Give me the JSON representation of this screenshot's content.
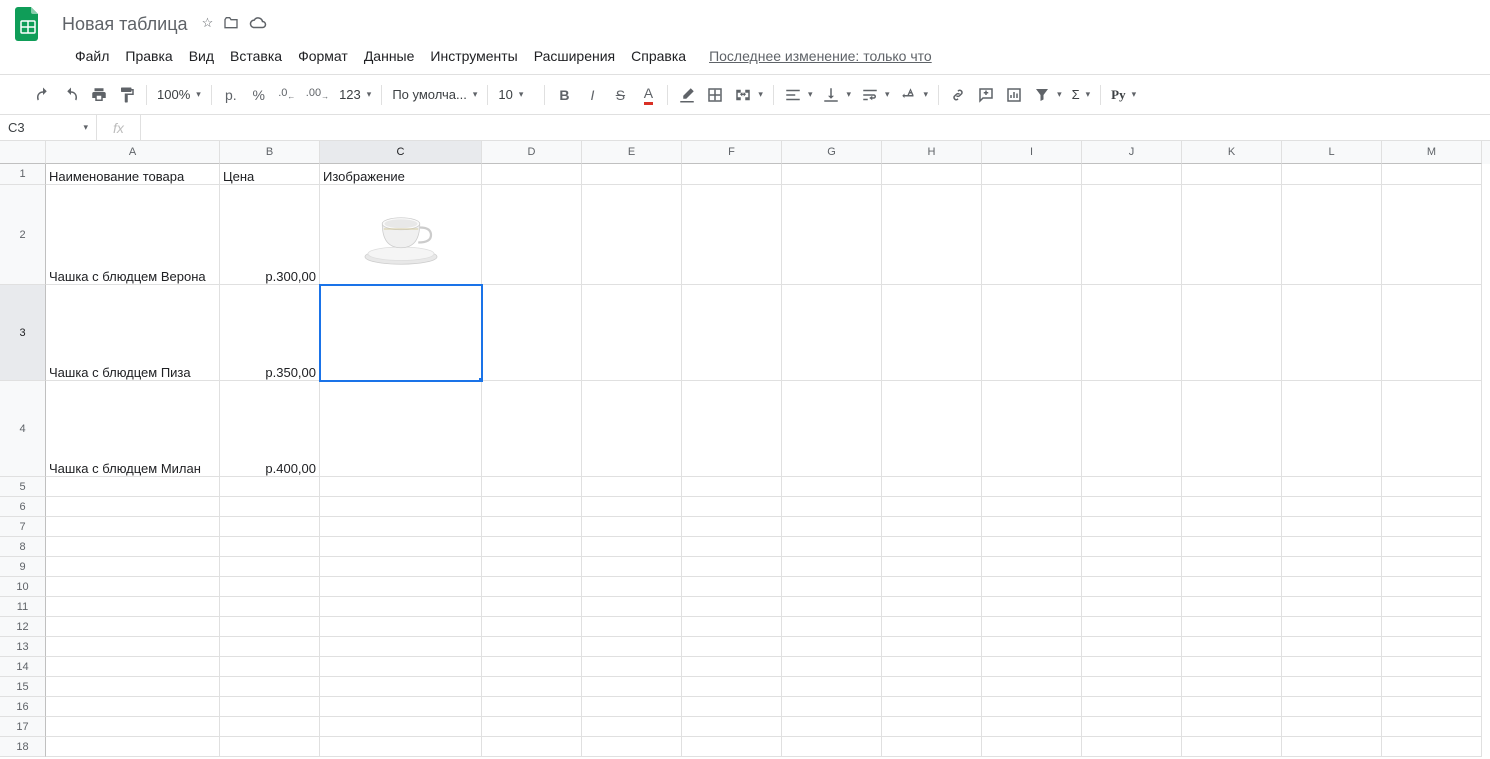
{
  "header": {
    "doc_title": "Новая таблица",
    "menus": [
      "Файл",
      "Правка",
      "Вид",
      "Вставка",
      "Формат",
      "Данные",
      "Инструменты",
      "Расширения",
      "Справка"
    ],
    "last_edit": "Последнее изменение: только что"
  },
  "toolbar": {
    "zoom": "100%",
    "font": "По умолча...",
    "font_size": "10",
    "currency": "р.",
    "percent": "%",
    "dec_less": ".0",
    "dec_more": ".00",
    "num_format": "123"
  },
  "name_box": "C3",
  "columns": [
    {
      "id": "rowhead",
      "label": "",
      "w": 46
    },
    {
      "id": "A",
      "label": "A",
      "w": 174
    },
    {
      "id": "B",
      "label": "B",
      "w": 100
    },
    {
      "id": "C",
      "label": "C",
      "w": 162
    },
    {
      "id": "D",
      "label": "D",
      "w": 100
    },
    {
      "id": "E",
      "label": "E",
      "w": 100
    },
    {
      "id": "F",
      "label": "F",
      "w": 100
    },
    {
      "id": "G",
      "label": "G",
      "w": 100
    },
    {
      "id": "H",
      "label": "H",
      "w": 100
    },
    {
      "id": "I",
      "label": "I",
      "w": 100
    },
    {
      "id": "J",
      "label": "J",
      "w": 100
    },
    {
      "id": "K",
      "label": "K",
      "w": 100
    },
    {
      "id": "L",
      "label": "L",
      "w": 100
    },
    {
      "id": "M",
      "label": "M",
      "w": 100
    }
  ],
  "rows": [
    {
      "n": 1,
      "h": 21,
      "A": "Наименование товара",
      "B": "Цена",
      "C": "Изображение"
    },
    {
      "n": 2,
      "h": 100,
      "A": "Чашка с блюдцем Верона",
      "B": "р.300,00",
      "C_img": true
    },
    {
      "n": 3,
      "h": 96,
      "A": "Чашка с блюдцем Пиза",
      "B": "р.350,00",
      "sel": "C"
    },
    {
      "n": 4,
      "h": 96,
      "A": "Чашка с блюдцем Милан",
      "B": "р.400,00"
    },
    {
      "n": 5,
      "h": 20
    },
    {
      "n": 6,
      "h": 20
    },
    {
      "n": 7,
      "h": 20
    },
    {
      "n": 8,
      "h": 20
    },
    {
      "n": 9,
      "h": 20
    },
    {
      "n": 10,
      "h": 20
    },
    {
      "n": 11,
      "h": 20
    },
    {
      "n": 12,
      "h": 20
    },
    {
      "n": 13,
      "h": 20
    },
    {
      "n": 14,
      "h": 20
    },
    {
      "n": 15,
      "h": 20
    },
    {
      "n": 16,
      "h": 20
    },
    {
      "n": 17,
      "h": 20
    },
    {
      "n": 18,
      "h": 20
    }
  ],
  "selected_col": "C",
  "selected_row": 3
}
